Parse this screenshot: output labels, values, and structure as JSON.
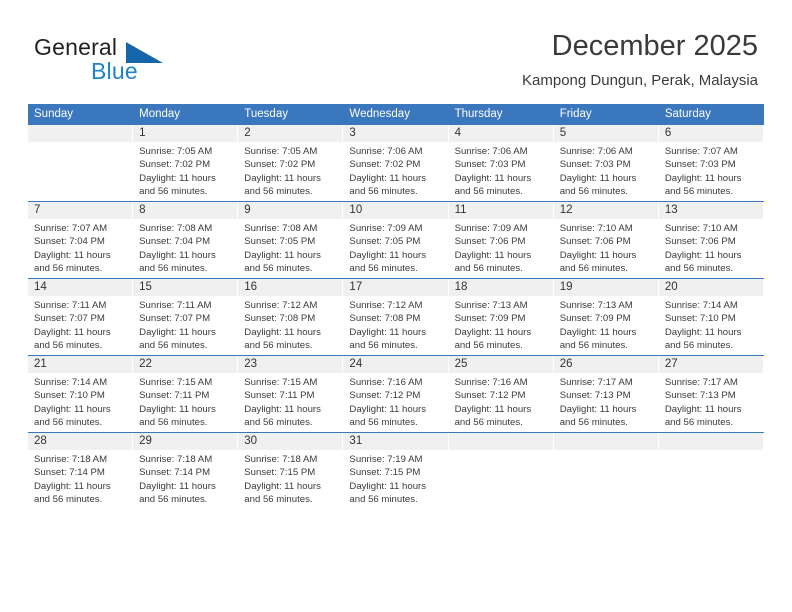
{
  "logo": {
    "primary_text": "General",
    "secondary_text": "Blue",
    "primary_color": "#231f20",
    "secondary_color": "#1e83c8",
    "triangle_color": "#1565aa"
  },
  "header": {
    "title": "December 2025",
    "subtitle": "Kampong Dungun, Perak, Malaysia"
  },
  "theme": {
    "header_blue": "#3a77bd",
    "day_band_gray": "#f0f0f0",
    "text_color": "#3a3a3a"
  },
  "weekdays": [
    "Sunday",
    "Monday",
    "Tuesday",
    "Wednesday",
    "Thursday",
    "Friday",
    "Saturday"
  ],
  "weeks": [
    [
      {
        "day": "",
        "sunrise": "",
        "sunset": "",
        "daylight_line1": "",
        "daylight_line2": ""
      },
      {
        "day": "1",
        "sunrise": "Sunrise: 7:05 AM",
        "sunset": "Sunset: 7:02 PM",
        "daylight_line1": "Daylight: 11 hours",
        "daylight_line2": "and 56 minutes."
      },
      {
        "day": "2",
        "sunrise": "Sunrise: 7:05 AM",
        "sunset": "Sunset: 7:02 PM",
        "daylight_line1": "Daylight: 11 hours",
        "daylight_line2": "and 56 minutes."
      },
      {
        "day": "3",
        "sunrise": "Sunrise: 7:06 AM",
        "sunset": "Sunset: 7:02 PM",
        "daylight_line1": "Daylight: 11 hours",
        "daylight_line2": "and 56 minutes."
      },
      {
        "day": "4",
        "sunrise": "Sunrise: 7:06 AM",
        "sunset": "Sunset: 7:03 PM",
        "daylight_line1": "Daylight: 11 hours",
        "daylight_line2": "and 56 minutes."
      },
      {
        "day": "5",
        "sunrise": "Sunrise: 7:06 AM",
        "sunset": "Sunset: 7:03 PM",
        "daylight_line1": "Daylight: 11 hours",
        "daylight_line2": "and 56 minutes."
      },
      {
        "day": "6",
        "sunrise": "Sunrise: 7:07 AM",
        "sunset": "Sunset: 7:03 PM",
        "daylight_line1": "Daylight: 11 hours",
        "daylight_line2": "and 56 minutes."
      }
    ],
    [
      {
        "day": "7",
        "sunrise": "Sunrise: 7:07 AM",
        "sunset": "Sunset: 7:04 PM",
        "daylight_line1": "Daylight: 11 hours",
        "daylight_line2": "and 56 minutes."
      },
      {
        "day": "8",
        "sunrise": "Sunrise: 7:08 AM",
        "sunset": "Sunset: 7:04 PM",
        "daylight_line1": "Daylight: 11 hours",
        "daylight_line2": "and 56 minutes."
      },
      {
        "day": "9",
        "sunrise": "Sunrise: 7:08 AM",
        "sunset": "Sunset: 7:05 PM",
        "daylight_line1": "Daylight: 11 hours",
        "daylight_line2": "and 56 minutes."
      },
      {
        "day": "10",
        "sunrise": "Sunrise: 7:09 AM",
        "sunset": "Sunset: 7:05 PM",
        "daylight_line1": "Daylight: 11 hours",
        "daylight_line2": "and 56 minutes."
      },
      {
        "day": "11",
        "sunrise": "Sunrise: 7:09 AM",
        "sunset": "Sunset: 7:06 PM",
        "daylight_line1": "Daylight: 11 hours",
        "daylight_line2": "and 56 minutes."
      },
      {
        "day": "12",
        "sunrise": "Sunrise: 7:10 AM",
        "sunset": "Sunset: 7:06 PM",
        "daylight_line1": "Daylight: 11 hours",
        "daylight_line2": "and 56 minutes."
      },
      {
        "day": "13",
        "sunrise": "Sunrise: 7:10 AM",
        "sunset": "Sunset: 7:06 PM",
        "daylight_line1": "Daylight: 11 hours",
        "daylight_line2": "and 56 minutes."
      }
    ],
    [
      {
        "day": "14",
        "sunrise": "Sunrise: 7:11 AM",
        "sunset": "Sunset: 7:07 PM",
        "daylight_line1": "Daylight: 11 hours",
        "daylight_line2": "and 56 minutes."
      },
      {
        "day": "15",
        "sunrise": "Sunrise: 7:11 AM",
        "sunset": "Sunset: 7:07 PM",
        "daylight_line1": "Daylight: 11 hours",
        "daylight_line2": "and 56 minutes."
      },
      {
        "day": "16",
        "sunrise": "Sunrise: 7:12 AM",
        "sunset": "Sunset: 7:08 PM",
        "daylight_line1": "Daylight: 11 hours",
        "daylight_line2": "and 56 minutes."
      },
      {
        "day": "17",
        "sunrise": "Sunrise: 7:12 AM",
        "sunset": "Sunset: 7:08 PM",
        "daylight_line1": "Daylight: 11 hours",
        "daylight_line2": "and 56 minutes."
      },
      {
        "day": "18",
        "sunrise": "Sunrise: 7:13 AM",
        "sunset": "Sunset: 7:09 PM",
        "daylight_line1": "Daylight: 11 hours",
        "daylight_line2": "and 56 minutes."
      },
      {
        "day": "19",
        "sunrise": "Sunrise: 7:13 AM",
        "sunset": "Sunset: 7:09 PM",
        "daylight_line1": "Daylight: 11 hours",
        "daylight_line2": "and 56 minutes."
      },
      {
        "day": "20",
        "sunrise": "Sunrise: 7:14 AM",
        "sunset": "Sunset: 7:10 PM",
        "daylight_line1": "Daylight: 11 hours",
        "daylight_line2": "and 56 minutes."
      }
    ],
    [
      {
        "day": "21",
        "sunrise": "Sunrise: 7:14 AM",
        "sunset": "Sunset: 7:10 PM",
        "daylight_line1": "Daylight: 11 hours",
        "daylight_line2": "and 56 minutes."
      },
      {
        "day": "22",
        "sunrise": "Sunrise: 7:15 AM",
        "sunset": "Sunset: 7:11 PM",
        "daylight_line1": "Daylight: 11 hours",
        "daylight_line2": "and 56 minutes."
      },
      {
        "day": "23",
        "sunrise": "Sunrise: 7:15 AM",
        "sunset": "Sunset: 7:11 PM",
        "daylight_line1": "Daylight: 11 hours",
        "daylight_line2": "and 56 minutes."
      },
      {
        "day": "24",
        "sunrise": "Sunrise: 7:16 AM",
        "sunset": "Sunset: 7:12 PM",
        "daylight_line1": "Daylight: 11 hours",
        "daylight_line2": "and 56 minutes."
      },
      {
        "day": "25",
        "sunrise": "Sunrise: 7:16 AM",
        "sunset": "Sunset: 7:12 PM",
        "daylight_line1": "Daylight: 11 hours",
        "daylight_line2": "and 56 minutes."
      },
      {
        "day": "26",
        "sunrise": "Sunrise: 7:17 AM",
        "sunset": "Sunset: 7:13 PM",
        "daylight_line1": "Daylight: 11 hours",
        "daylight_line2": "and 56 minutes."
      },
      {
        "day": "27",
        "sunrise": "Sunrise: 7:17 AM",
        "sunset": "Sunset: 7:13 PM",
        "daylight_line1": "Daylight: 11 hours",
        "daylight_line2": "and 56 minutes."
      }
    ],
    [
      {
        "day": "28",
        "sunrise": "Sunrise: 7:18 AM",
        "sunset": "Sunset: 7:14 PM",
        "daylight_line1": "Daylight: 11 hours",
        "daylight_line2": "and 56 minutes."
      },
      {
        "day": "29",
        "sunrise": "Sunrise: 7:18 AM",
        "sunset": "Sunset: 7:14 PM",
        "daylight_line1": "Daylight: 11 hours",
        "daylight_line2": "and 56 minutes."
      },
      {
        "day": "30",
        "sunrise": "Sunrise: 7:18 AM",
        "sunset": "Sunset: 7:15 PM",
        "daylight_line1": "Daylight: 11 hours",
        "daylight_line2": "and 56 minutes."
      },
      {
        "day": "31",
        "sunrise": "Sunrise: 7:19 AM",
        "sunset": "Sunset: 7:15 PM",
        "daylight_line1": "Daylight: 11 hours",
        "daylight_line2": "and 56 minutes."
      },
      {
        "day": "",
        "sunrise": "",
        "sunset": "",
        "daylight_line1": "",
        "daylight_line2": ""
      },
      {
        "day": "",
        "sunrise": "",
        "sunset": "",
        "daylight_line1": "",
        "daylight_line2": ""
      },
      {
        "day": "",
        "sunrise": "",
        "sunset": "",
        "daylight_line1": "",
        "daylight_line2": ""
      }
    ]
  ]
}
